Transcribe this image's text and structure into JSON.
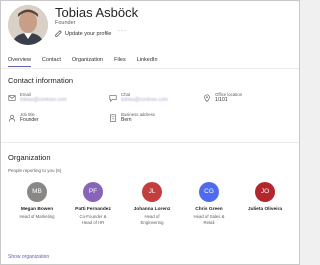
{
  "profile": {
    "name": "Tobias Asböck",
    "role": "Founder",
    "update_label": "Update your profile",
    "more_label": "···"
  },
  "tabs": [
    {
      "label": "Overview"
    },
    {
      "label": "Contact"
    },
    {
      "label": "Organization"
    },
    {
      "label": "Files"
    },
    {
      "label": "LinkedIn"
    }
  ],
  "contact": {
    "title": "Contact information",
    "email": {
      "label": "Email",
      "value": "tobias@contoso.com",
      "icon": "mail-icon"
    },
    "chat": {
      "label": "Chat",
      "value": "tobias@contoso.com",
      "icon": "chat-icon"
    },
    "office": {
      "label": "Office location",
      "value": "1/101",
      "icon": "location-icon"
    },
    "job_title": {
      "label": "Job title",
      "value": "Founder",
      "icon": "person-icon"
    },
    "business_address": {
      "label": "Business address",
      "value": "Bern",
      "icon": "building-icon"
    }
  },
  "organization": {
    "title": "Organization",
    "subtitle": "People reporting to you (5)",
    "people": [
      {
        "initials": "MB",
        "name": "Megan Bowen",
        "title": "Head of Marketing",
        "color": "#8a8886"
      },
      {
        "initials": "PF",
        "name": "Patti Fernandez",
        "title": "Co-Founder & Head of HR",
        "color": "#8764b8"
      },
      {
        "initials": "JL",
        "name": "Johanna Lorenz",
        "title": "Head of Engineering",
        "color": "#c43e3e"
      },
      {
        "initials": "CG",
        "name": "Chris Green",
        "title": "Head of Sales & Retail",
        "color": "#4f6bed"
      },
      {
        "initials": "JO",
        "name": "Julieta Oliveira",
        "title": "",
        "color": "#b3272c"
      }
    ],
    "show_label": "Show organization"
  },
  "colors": {
    "accent": "#6264a7"
  }
}
